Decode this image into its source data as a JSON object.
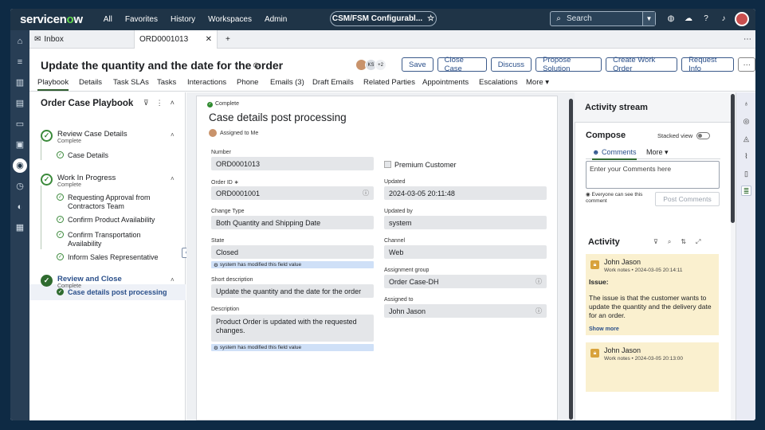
{
  "topbar": {
    "logo_a": "servicen",
    "logo_o": "o",
    "logo_b": "w",
    "nav": [
      "All",
      "Favorites",
      "History",
      "Workspaces",
      "Admin"
    ],
    "workspace_pill": "CSM/FSM Configurabl...",
    "search_placeholder": "Search"
  },
  "tabs": {
    "inbox": "Inbox",
    "record": "ORD0001013",
    "close": "✕",
    "add": "+"
  },
  "record": {
    "title": "Update the quantity and the date for the order",
    "avatar_ks": "KS",
    "avatar_count": "+2",
    "buttons": [
      "Save",
      "Close Case",
      "Discuss",
      "Propose Solution",
      "Create Work Order",
      "Request Info"
    ],
    "more_button": "···"
  },
  "subtabs": [
    "Playbook",
    "Details",
    "Task SLAs",
    "Tasks",
    "Interactions",
    "Phone",
    "Emails (3)",
    "Draft Emails",
    "Related Parties",
    "Appointments",
    "Escalations",
    "More ▾"
  ],
  "playbook": {
    "title": "Order Case Playbook",
    "stages": [
      {
        "name": "Review Case Details",
        "status": "Complete"
      },
      {
        "name": "Work In Progress",
        "status": "Complete"
      },
      {
        "name": "Review and Close",
        "status": "Complete"
      }
    ],
    "activities": [
      "Case Details",
      "Requesting Approval from Contractors Team",
      "Confirm Product Availability",
      "Confirm Transportation Availability",
      "Inform Sales Representative",
      "Case details post processing"
    ]
  },
  "card": {
    "status": "Complete",
    "title": "Case details post processing",
    "assigned": "Assigned to Me",
    "modified_note": "system has modified this field value",
    "labels": {
      "number": "Number",
      "order_id": "Order ID ∗",
      "change_type": "Change Type",
      "state": "State",
      "short_desc": "Short description",
      "description": "Description",
      "updated": "Updated",
      "updated_by": "Updated by",
      "channel": "Channel",
      "assignment_group": "Assignment group",
      "assigned_to": "Assigned to"
    },
    "values": {
      "number": "ORD0001013",
      "order_id": "ORD0001001",
      "change_type": "Both Quantity and Shipping Date",
      "state": "Closed",
      "short_desc": "Update the quantity and the date for the order",
      "description": "Product Order is updated with the requested changes.",
      "premium": "Premium Customer",
      "updated": "2024-03-05 20:11:48",
      "updated_by": "system",
      "channel": "Web",
      "assignment_group": "Order Case-DH",
      "assigned_to": "John Jason"
    }
  },
  "activity_stream": {
    "title": "Activity stream",
    "compose": "Compose",
    "stacked_view": "Stacked view",
    "comments_tab": "Comments",
    "more_tab": "More ▾",
    "placeholder": "Enter your Comments here",
    "visibility": "Everyone can see this comment",
    "post": "Post Comments",
    "activity_title": "Activity",
    "entries": [
      {
        "name": "John Jason",
        "meta": "Work notes • 2024-03-05 20:14:11",
        "label": "Issue:",
        "body": "The issue is that the customer wants to update the quantity and the delivery date for an order.",
        "more": "Show more"
      },
      {
        "name": "John Jason",
        "meta": "Work notes • 2024-03-05 20:13:00"
      }
    ]
  },
  "colors": {
    "topbar": "#1f3447",
    "accent_green": "#2f6b2f",
    "link_blue": "#2a4f8a",
    "note_yellow": "#faf0cf"
  }
}
